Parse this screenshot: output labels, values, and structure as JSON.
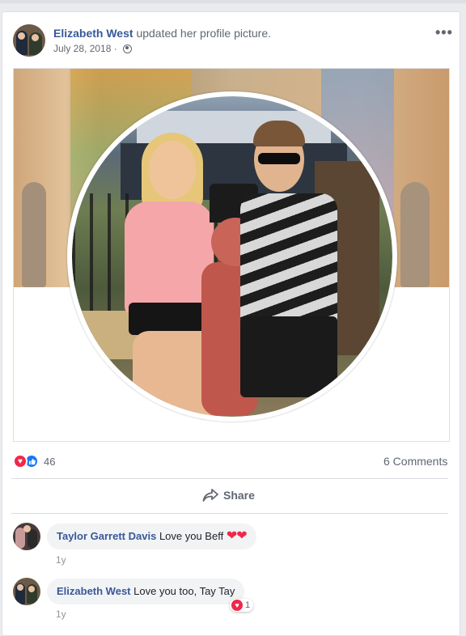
{
  "post": {
    "author": "Elizabeth West",
    "action": "updated her profile picture.",
    "date": "July 28, 2018",
    "date_sep": "·",
    "more_label": "•••",
    "privacy_icon": "globe-icon"
  },
  "reactions": {
    "count": "46",
    "love_icon": "♥",
    "like_icon": "👍",
    "comments_label": "6 Comments"
  },
  "actions": {
    "share_label": "Share"
  },
  "comments": [
    {
      "author": "Taylor Garrett Davis",
      "text": "Love you Beff",
      "emoji": "❤❤",
      "age": "1y"
    },
    {
      "author": "Elizabeth West",
      "text": "Love you too, Tay Tay",
      "reaction_count": "1",
      "reaction_icon": "♥",
      "age": "1y"
    }
  ],
  "colors": {
    "link": "#385898",
    "love": "#f0284a",
    "like": "#1877f2",
    "bubble": "#f2f3f5"
  }
}
